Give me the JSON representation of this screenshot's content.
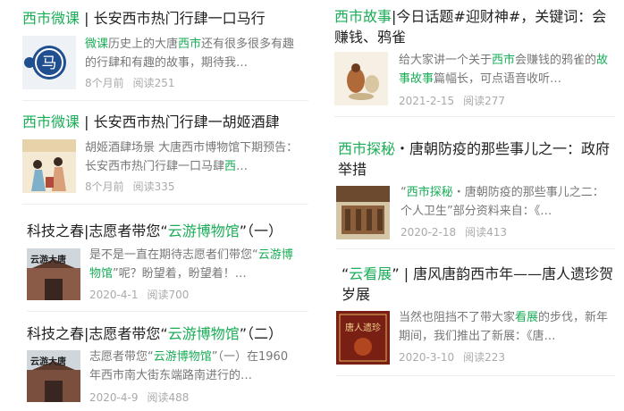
{
  "left": [
    {
      "title": [
        {
          "t": "西市微课",
          "hl": true
        },
        {
          "t": " | 长安西市热门行肆一口马行",
          "hl": false
        }
      ],
      "snippet": [
        {
          "t": "微课",
          "hl": true
        },
        {
          "t": "历史上的大唐",
          "hl": false
        },
        {
          "t": "西市",
          "hl": true
        },
        {
          "t": "还有很多很多有趣的行肆和有趣的故事，期待我…",
          "hl": false
        }
      ],
      "date": "8个月前",
      "reads": "阅读251",
      "thumb": "horse-mark-thumbnail",
      "thumb_char": "马"
    },
    {
      "title": [
        {
          "t": "西市微课",
          "hl": true
        },
        {
          "t": " | 长安西市热门行肆一胡姬酒肆",
          "hl": false
        }
      ],
      "snippet": [
        {
          "t": "胡姬酒肆场景 大唐西市博物馆下期预告：长安西市热门行肆一口马肆",
          "hl": false
        },
        {
          "t": "西",
          "hl": true
        },
        {
          "t": "…",
          "hl": false
        }
      ],
      "date": "8个月前",
      "reads": "阅读335",
      "thumb": "tavern-painting-thumbnail"
    },
    {
      "title": [
        {
          "t": "科技之春|志愿者带您“",
          "hl": false
        },
        {
          "t": "云游博物馆",
          "hl": true
        },
        {
          "t": "”（一）",
          "hl": false
        }
      ],
      "snippet": [
        {
          "t": "是不是一直在期待志愿者们带您“",
          "hl": false
        },
        {
          "t": "云游博物馆",
          "hl": true
        },
        {
          "t": "”呢？盼望着，盼望着！…",
          "hl": false
        }
      ],
      "date": "2020-4-1",
      "reads": "阅读700",
      "thumb": "museum-building-thumbnail",
      "thumb_char": "云游大唐"
    },
    {
      "title": [
        {
          "t": "科技之春|志愿者带您“",
          "hl": false
        },
        {
          "t": "云游博物馆",
          "hl": true
        },
        {
          "t": "”（二）",
          "hl": false
        }
      ],
      "snippet": [
        {
          "t": "志愿者带您“",
          "hl": false
        },
        {
          "t": "云游博物馆",
          "hl": true
        },
        {
          "t": "”（一）在1960年西市南大街东端路南进行的…",
          "hl": false
        }
      ],
      "date": "2020-4-9",
      "reads": "阅读488",
      "thumb": "museum-building-thumbnail",
      "thumb_char": "云游大唐"
    }
  ],
  "right": [
    {
      "title": [
        {
          "t": "西市故事",
          "hl": true
        },
        {
          "t": "|今日话题#迎财神#，关键词：会赚钱、鸦雀",
          "hl": false
        }
      ],
      "snippet": [
        {
          "t": "给大家讲一个关于",
          "hl": false
        },
        {
          "t": "西市",
          "hl": true
        },
        {
          "t": "会赚钱的鸦雀的",
          "hl": false
        },
        {
          "t": "故事故事",
          "hl": true
        },
        {
          "t": "篇幅长，可点语音收听…",
          "hl": false
        }
      ],
      "date": "2021-2-15",
      "reads": "阅读277",
      "thumb": "magpie-illustration-thumbnail"
    },
    {
      "title": [
        {
          "t": "西市探秘",
          "hl": true
        },
        {
          "t": "・唐朝防疫的那些事儿之一：政府举措",
          "hl": false
        }
      ],
      "snippet": [
        {
          "t": "“",
          "hl": false
        },
        {
          "t": "西市探秘",
          "hl": true
        },
        {
          "t": "・唐朝防疫的那些事儿之二：个人卫生”部分资料来自：《…",
          "hl": false
        }
      ],
      "date": "2020-2-18",
      "reads": "阅读413",
      "thumb": "museum-hall-thumbnail"
    },
    {
      "title": [
        {
          "t": "“",
          "hl": false
        },
        {
          "t": "云看展",
          "hl": true
        },
        {
          "t": "” | 唐风唐韵西市年——唐人遗珍贺岁展",
          "hl": false
        }
      ],
      "snippet": [
        {
          "t": "当然也阻挡不了带大家",
          "hl": false
        },
        {
          "t": "看展",
          "hl": true
        },
        {
          "t": "的步伐，新年期间，我们推出了新展：《唐…",
          "hl": false
        }
      ],
      "date": "2020-3-10",
      "reads": "阅读223",
      "thumb": "exhibition-poster-thumbnail",
      "thumb_char": "唐人遗珍"
    }
  ]
}
